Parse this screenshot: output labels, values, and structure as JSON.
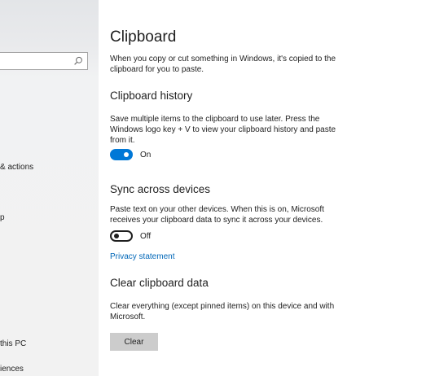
{
  "sidebar": {
    "search": {
      "placeholder": ""
    },
    "items": [
      {
        "label": "& actions"
      },
      {
        "label": "p"
      },
      {
        "label": "this PC"
      },
      {
        "label": "iences"
      }
    ]
  },
  "main": {
    "title": "Clipboard",
    "intro": "When you copy or cut something in Windows, it's copied to the clipboard for you to paste.",
    "history": {
      "title": "Clipboard history",
      "description": "Save multiple items to the clipboard to use later. Press the Windows logo key + V to view your clipboard history and paste from it.",
      "toggle_state": "On"
    },
    "sync": {
      "title": "Sync across devices",
      "description": "Paste text on your other devices. When this is on, Microsoft receives your clipboard data to sync it across your devices.",
      "toggle_state": "Off"
    },
    "privacy_link": "Privacy statement",
    "clear": {
      "title": "Clear clipboard data",
      "description": "Clear everything (except pinned items) on this device and with Microsoft.",
      "button_label": "Clear"
    }
  },
  "colors": {
    "accent": "#0078d7",
    "link": "#0067b8",
    "sidebar_bg": "#f2f2f2",
    "button_bg": "#cccccc"
  },
  "icons": {
    "search": "search-icon"
  }
}
